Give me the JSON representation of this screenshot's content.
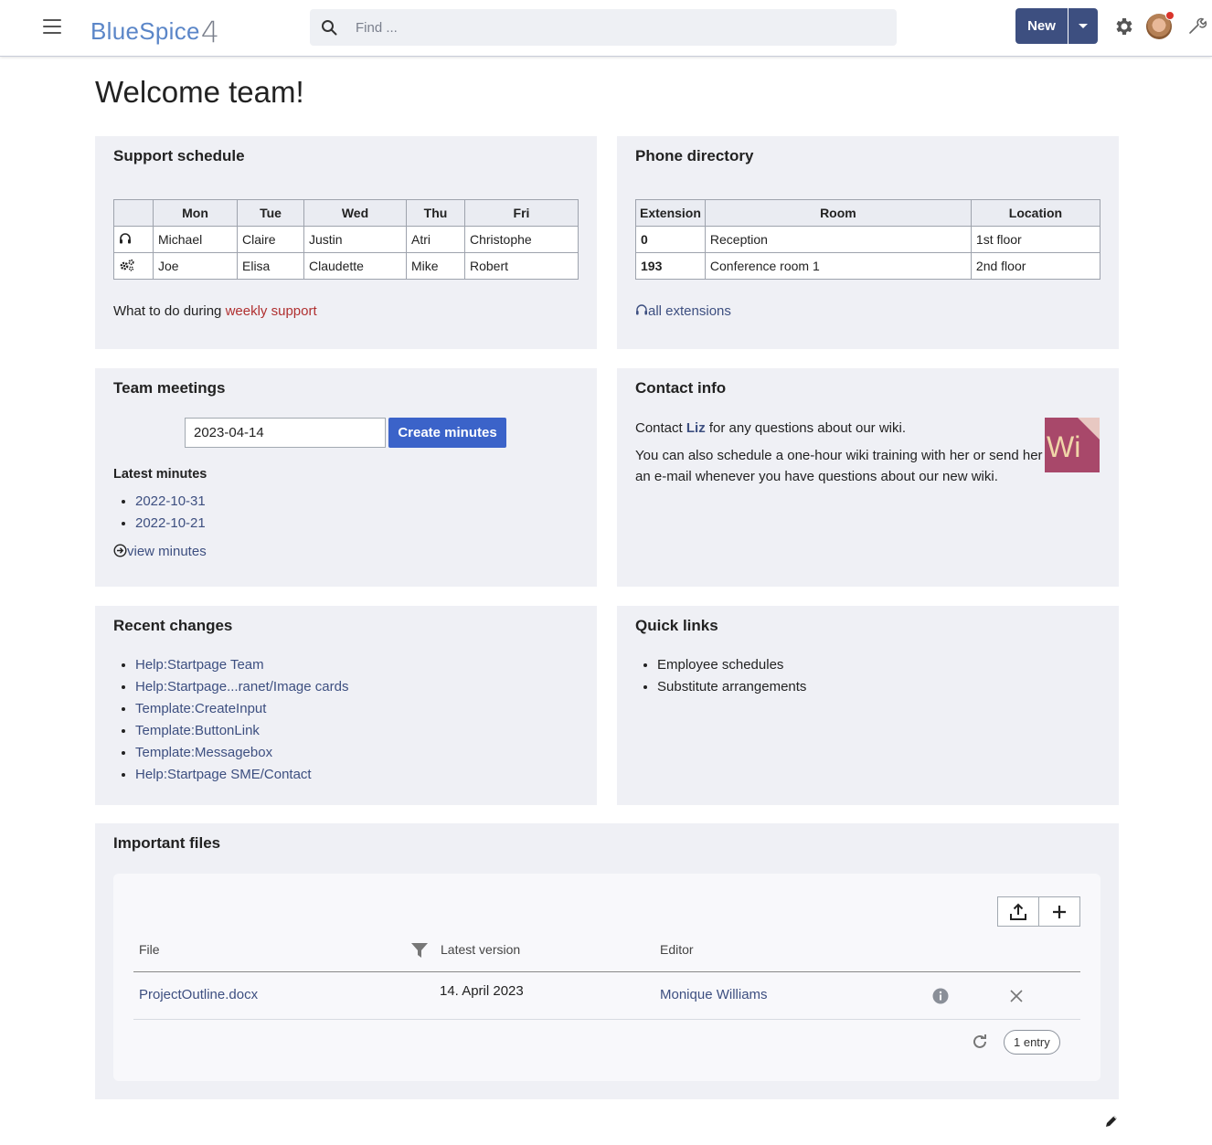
{
  "header": {
    "logo_text": "BlueSpice",
    "logo_version": "4",
    "search_placeholder": "Find ...",
    "new_label": "New"
  },
  "page_title": "Welcome team!",
  "support": {
    "title": "Support schedule",
    "columns": [
      "Mon",
      "Tue",
      "Wed",
      "Thu",
      "Fri"
    ],
    "rows": [
      {
        "icon": "headset-icon",
        "cells": [
          "Michael",
          "Claire",
          "Justin",
          "Atri",
          "Christophe"
        ]
      },
      {
        "icon": "gears-icon",
        "cells": [
          "Joe",
          "Elisa",
          "Claudette",
          "Mike",
          "Robert"
        ]
      }
    ],
    "note_prefix": "What to do during ",
    "note_link": "weekly support"
  },
  "phone": {
    "title": "Phone directory",
    "columns": [
      "Extension",
      "Room",
      "Location"
    ],
    "rows": [
      {
        "ext": "0",
        "room": "Reception",
        "location": "1st floor"
      },
      {
        "ext": "193",
        "room": "Conference room 1",
        "location": "2nd floor"
      }
    ],
    "link": "all extensions"
  },
  "meetings": {
    "title": "Team meetings",
    "date_value": "2023-04-14",
    "button": "Create minutes",
    "latest_title": "Latest minutes",
    "latest": [
      "2022-10-31",
      "2022-10-21"
    ],
    "view_link": "view minutes"
  },
  "contact": {
    "title": "Contact info",
    "line1_prefix": "Contact ",
    "line1_name": "Liz",
    "line1_suffix": " for any questions about our wiki.",
    "line2a": "You can also schedule a one-hour wiki training with her or send her",
    "line2b": "an e-mail whenever you have questions about our new wiki.",
    "image_text": "Wi"
  },
  "recent": {
    "title": "Recent changes",
    "items": [
      "Help:Startpage Team",
      "Help:Startpage...ranet/Image cards",
      "Template:CreateInput",
      "Template:ButtonLink",
      "Template:Messagebox",
      "Help:Startpage SME/Contact"
    ]
  },
  "quicklinks": {
    "title": "Quick links",
    "items": [
      "Employee schedules",
      "Substitute arrangements"
    ]
  },
  "files": {
    "title": "Important files",
    "col_file": "File",
    "col_version": "Latest version",
    "col_editor": "Editor",
    "row": {
      "file": "ProjectOutline.docx",
      "version": "14. April 2023",
      "editor": "Monique Williams"
    },
    "count": "1 entry"
  },
  "colors": {
    "primary": "#3d4f80",
    "button_blue": "#3b63c9",
    "card_bg": "#eff0f5",
    "red_link": "#b03030"
  }
}
